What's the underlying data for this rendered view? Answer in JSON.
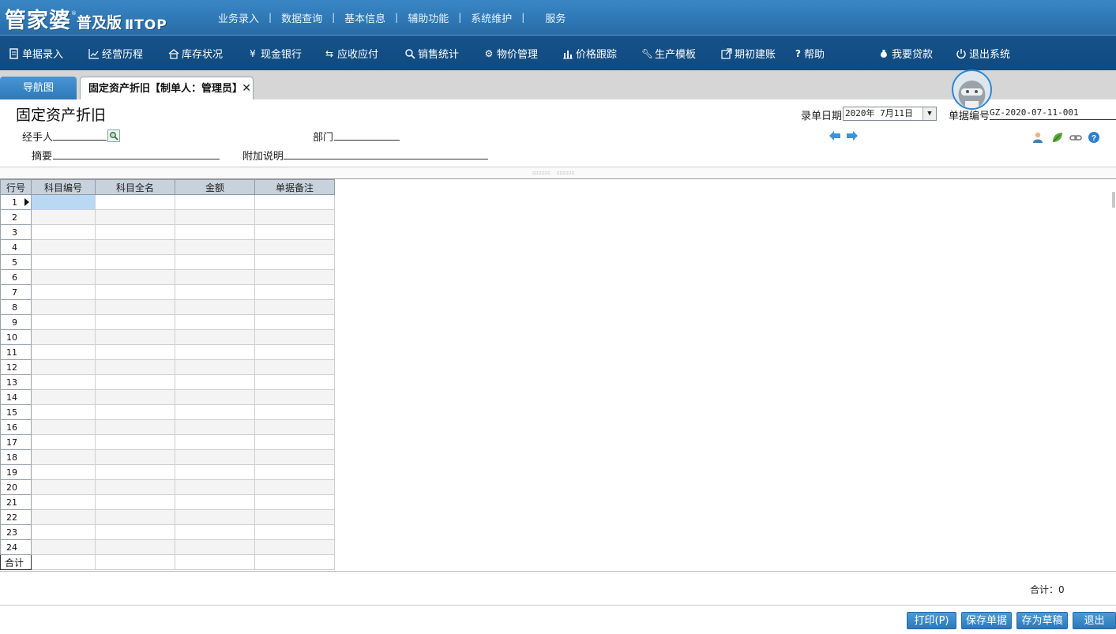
{
  "logo": {
    "main": "管家婆",
    "reg": "®",
    "edition": "普及版",
    "suffix": "ⅡTOP"
  },
  "top_menu": [
    "业务录入",
    "数据查询",
    "基本信息",
    "辅助功能",
    "系统维护",
    "服务"
  ],
  "menu_bar": [
    {
      "label": "单据录入",
      "icon": "document-icon"
    },
    {
      "label": "经营历程",
      "icon": "line-chart-icon"
    },
    {
      "label": "库存状况",
      "icon": "home-icon"
    },
    {
      "label": "现金银行",
      "icon": "yen-icon"
    },
    {
      "label": "应收应付",
      "icon": "exchange-icon"
    },
    {
      "label": "销售统计",
      "icon": "search-icon"
    },
    {
      "label": "物价管理",
      "icon": "gear-icon"
    },
    {
      "label": "价格跟踪",
      "icon": "bar-chart-icon"
    },
    {
      "label": "生产模板",
      "icon": "wrench-icon"
    },
    {
      "label": "期初建账",
      "icon": "external-link-icon"
    },
    {
      "label": "帮助",
      "icon": "question-icon"
    },
    {
      "label": "我要贷款",
      "icon": "money-bag-icon"
    },
    {
      "label": "退出系统",
      "icon": "power-icon"
    }
  ],
  "tabs": {
    "nav": "导航图",
    "doc": "固定资产折旧【制单人：管理员】",
    "close": "✕"
  },
  "form": {
    "title": "固定资产折旧",
    "date_label": "录单日期",
    "date_value": "2020年  7月11日",
    "bill_no_label": "单据编号",
    "bill_no": "GZ-2020-07-11-001",
    "handler_label": "经手人",
    "dept_label": "部门",
    "summary_label": "摘要",
    "note_label": "附加说明"
  },
  "grid": {
    "headers": [
      "行号",
      "科目编号",
      "科目全名",
      "金额",
      "单据备注"
    ],
    "rows": [
      "1",
      "2",
      "3",
      "4",
      "5",
      "6",
      "7",
      "8",
      "9",
      "10",
      "11",
      "12",
      "13",
      "14",
      "15",
      "16",
      "17",
      "18",
      "19",
      "20",
      "21",
      "22",
      "23",
      "24"
    ],
    "total_label": "合计"
  },
  "footer": {
    "total": "合计：0",
    "buttons": [
      "打印(P)",
      "保存单据",
      "存为草稿",
      "退出"
    ]
  },
  "colors": {
    "topbar": "#2f78b6",
    "menubar": "#0f4a80",
    "button": "#2c78b8",
    "selected_cell": "#b9d8f4"
  }
}
